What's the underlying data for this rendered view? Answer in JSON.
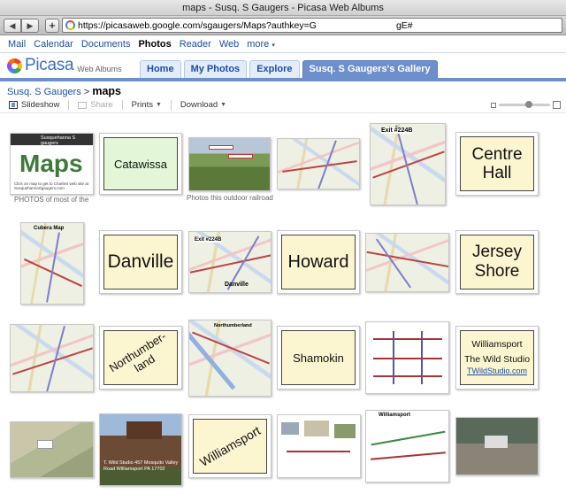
{
  "window": {
    "title": "maps - Susq. S Gaugers - Picasa Web Albums"
  },
  "browser": {
    "back_icon": "back-arrow-icon",
    "forward_icon": "forward-arrow-icon",
    "add_label": "+",
    "url": "https://picasaweb.google.com/sgaugers/Maps?authkey=G",
    "url_tail": "gE#"
  },
  "gbar": {
    "links": [
      "Mail",
      "Calendar",
      "Documents",
      "Photos",
      "Reader",
      "Web",
      "more"
    ],
    "current": "Photos"
  },
  "picasa": {
    "logo": "Picasa",
    "logo_sub": "Web Albums",
    "tabs": [
      "Home",
      "My Photos",
      "Explore",
      "Susq. S Gaugers's Gallery"
    ],
    "selected_tab": "Susq. S Gaugers's Gallery",
    "accent": "#6d8fcb"
  },
  "breadcrumb": {
    "owner": "Susq. S Gaugers",
    "separator": ">",
    "album": "maps"
  },
  "actions": {
    "slideshow": "Slideshow",
    "share": "Share",
    "prints": "Prints",
    "download": "Download"
  },
  "photos": {
    "captions": {
      "c0": "PHOTOS of most of the",
      "c2": "Photos this outdoor railroad"
    },
    "items": {
      "maps_title": "Maps",
      "maps_header": "Susquehanna S gaugers",
      "maps_small": "Click on map to get to Charlies web site at SusquehannaSgaugers.com",
      "catawissa": "Catawissa",
      "centre_hall": "Centre\nHall",
      "danville": "Danville",
      "howard": "Howard",
      "jersey_shore": "Jersey\nShore",
      "northumberland": "Northumber-\nland",
      "shamokin": "Shamokin",
      "williamsport": "Williamsport",
      "williamsport_card_title": "Williamsport",
      "wild_studio": "The Wild Studio",
      "wild_studio_link": "TWildStudio.com",
      "exit_label": "Exit #224B",
      "danville_map_label": "Danville",
      "columbia_map_label": "Cubera Map",
      "williamsport_map_label": "Williamsport",
      "northumberland_map_label": "Northumberland",
      "photo_caption": "T. Wild Studio 457 Mosquito Valley Road Williamsport PA 17702"
    }
  }
}
